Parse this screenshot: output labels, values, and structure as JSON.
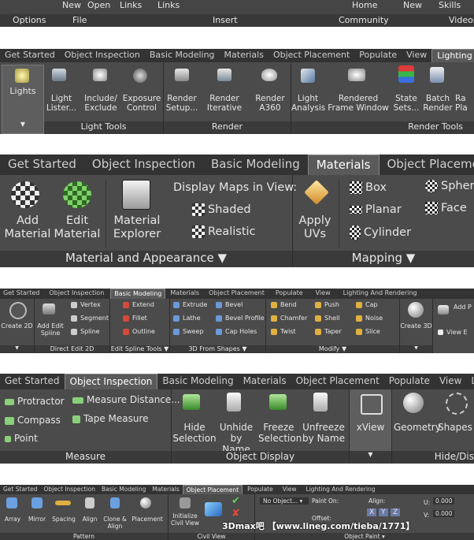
{
  "ribbon1": {
    "buttons": [
      "New",
      "Open",
      "Links",
      "Links",
      "Home",
      "New",
      "Skills"
    ],
    "panels": [
      "Options",
      "File",
      "Insert",
      "Community",
      "Videos"
    ]
  },
  "ribbon2": {
    "tabs": [
      "Get Started",
      "Object Inspection",
      "Basic Modeling",
      "Materials",
      "Object Placement",
      "Populate",
      "View",
      "Lighting"
    ],
    "buttons": [
      "Lights",
      "Light Lister...",
      "Include/ Exclude",
      "Exposure Control",
      "Render Setup...",
      "Render Iterative",
      "Render A360",
      "Light Analysis",
      "Rendered Frame Window",
      "State Sets...",
      "Batch Render",
      "Ra Pla"
    ],
    "panels": [
      "Light Tools",
      "Render",
      "Render Tools"
    ]
  },
  "ribbon3": {
    "tabs": [
      "Get Started",
      "Object Inspection",
      "Basic Modeling",
      "Materials",
      "Object Placement"
    ],
    "buttons": [
      "Add Material",
      "Edit Material",
      "Material Explorer",
      "Apply UVs"
    ],
    "maps_title": "Display Maps in View:",
    "maps": [
      "Shaded",
      "Realistic"
    ],
    "mapping": [
      "Box",
      "Planar",
      "Cylinder",
      "Spher",
      "Face"
    ],
    "panels": [
      "Material and Appearance",
      "Mapping"
    ]
  },
  "ribbon4": {
    "tabs": [
      "Get Started",
      "Object Inspection",
      "Basic Modeling",
      "Materials",
      "Object Placement",
      "Populate",
      "View",
      "Lighting And Rendering"
    ],
    "buttons": [
      "Create 2D",
      "Add Edit Spline",
      "Create 3D",
      "Add P",
      "View E"
    ],
    "spline": [
      "Vertex",
      "Segment",
      "Spline"
    ],
    "spline_tools": [
      "Extend",
      "Fillet",
      "Outline"
    ],
    "shapes": [
      "Extrude",
      "Lathe",
      "Sweep",
      "Bevel",
      "Bevel Profile",
      "Cap Holes"
    ],
    "modify": [
      "Bend",
      "Chamfer",
      "Twist",
      "Push",
      "Shell",
      "Taper",
      "Cap",
      "Noise",
      "Slice"
    ],
    "panels": [
      "Direct Edit 2D",
      "Edit Spline Tools",
      "3D From Shapes",
      "Modify"
    ]
  },
  "ribbon5": {
    "tabs": [
      "Get Started",
      "Object Inspection",
      "Basic Modeling",
      "Materials",
      "Object Placement",
      "Populate",
      "View",
      "Lig"
    ],
    "measure": [
      "Protractor",
      "Compass",
      "Point",
      "Measure Distance...",
      "Tape Measure"
    ],
    "buttons": [
      "Hide Selection",
      "Unhide by Name",
      "Freeze Selection",
      "Unfreeze by Name",
      "xView",
      "Geometry",
      "Shapes"
    ],
    "panels": [
      "Measure",
      "Object Display",
      "Hide/Dis"
    ]
  },
  "ribbon6": {
    "tabs": [
      "Get Started",
      "Object Inspection",
      "Basic Modeling",
      "Materials",
      "Object Placement",
      "Populate",
      "View",
      "Lighting And Rendering"
    ],
    "buttons": [
      "Array",
      "Mirror",
      "Spacing",
      "Align",
      "Clone & Align",
      "Placement",
      "Initialize Civil View"
    ],
    "fields": [
      "No Object...",
      "Paint On:",
      "Offset:",
      "Align:",
      "U:",
      "V:"
    ],
    "values": [
      "0.000",
      "0.000"
    ],
    "axes": [
      "X",
      "Y",
      "Z"
    ],
    "panels": [
      "Pattern",
      "Civil View",
      "Object Paint"
    ]
  },
  "watermark": "3Dmax吧 【www.lineg.com/tieba/1771】"
}
